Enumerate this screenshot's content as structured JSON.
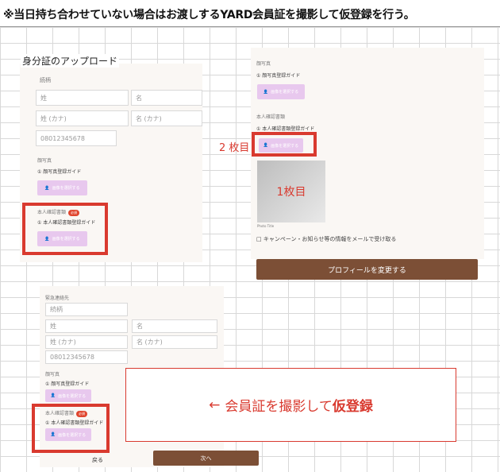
{
  "note": "※当日持ち合わせていない場合はお渡しするYARD会員証を撮影して仮登録を行う。",
  "section_title": "身分証のアップロード",
  "form1": {
    "nickname_placeholder": "続柄",
    "last_name_placeholder": "姓",
    "first_name_placeholder": "名",
    "last_kana_placeholder": "姓 (カナ)",
    "first_kana_placeholder": "名 (カナ)",
    "phone_value": "08012345678",
    "photo_label": "顔写真",
    "photo_guide": "① 顔写真登録ガイド",
    "select_image": "画像を選択する",
    "id_label": "本人確認書類",
    "required": "必須",
    "id_guide": "① 本人確認書類登録ガイド"
  },
  "form2": {
    "photo_label": "顔写真",
    "photo_guide": "① 顔写真登録ガイド",
    "select_image": "画像を選択する",
    "id_label": "本人確認書類",
    "id_guide": "① 本人確認書類登録ガイド",
    "second_label": "2 枚目",
    "first_label": "1枚目",
    "thumb_caption": "Photo Title",
    "campaign_checkbox": "□ キャンペーン・お知らせ等の情報をメールで受け取る",
    "profile_button": "プロフィールを変更する"
  },
  "form3": {
    "emergency_label": "緊急連絡先",
    "nickname_placeholder": "続柄",
    "last_name_placeholder": "姓",
    "first_name_placeholder": "名",
    "last_kana_placeholder": "姓 (カナ)",
    "first_kana_placeholder": "名 (カナ)",
    "phone_value": "08012345678",
    "photo_label": "顔写真",
    "photo_guide": "① 顔写真登録ガイド",
    "select_image": "画像を選択する",
    "id_label": "本人確認書類",
    "required": "必須",
    "id_guide": "① 本人確認書類登録ガイド",
    "back": "戻る",
    "next": "次へ"
  },
  "callout": {
    "arrow": "←",
    "text": "会員証を撮影して",
    "bold": "仮登録"
  },
  "colors": {
    "highlight": "#d93a2f",
    "brown": "#7c4f36",
    "pink_button": "#e8c8ee"
  }
}
